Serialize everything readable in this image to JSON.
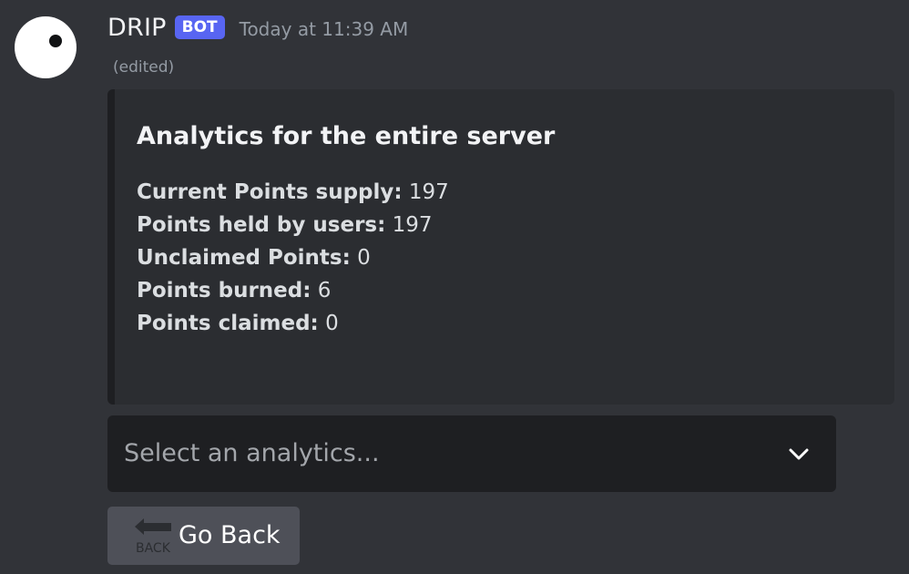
{
  "message": {
    "username": "DRIP",
    "bot_tag": "BOT",
    "timestamp": "Today at 11:39 AM",
    "edited": "(edited)"
  },
  "embed": {
    "title": "Analytics for the entire server",
    "fields": [
      {
        "label": "Current Points supply:",
        "value": "197"
      },
      {
        "label": "Points held by users:",
        "value": "197"
      },
      {
        "label": "Unclaimed Points:",
        "value": "0"
      },
      {
        "label": "Points burned:",
        "value": "6"
      },
      {
        "label": "Points claimed:",
        "value": "0"
      }
    ]
  },
  "select": {
    "placeholder": "Select an analytics...",
    "icon": "chevron-down-icon"
  },
  "back_button": {
    "icon_text": "BACK",
    "label": "Go Back",
    "icon": "back-arrow-icon"
  },
  "colors": {
    "background": "#313338",
    "embed_background": "#2b2d31",
    "bot_tag": "#5865f2",
    "select_background": "#1e1f22",
    "button_background": "#4e5058"
  }
}
